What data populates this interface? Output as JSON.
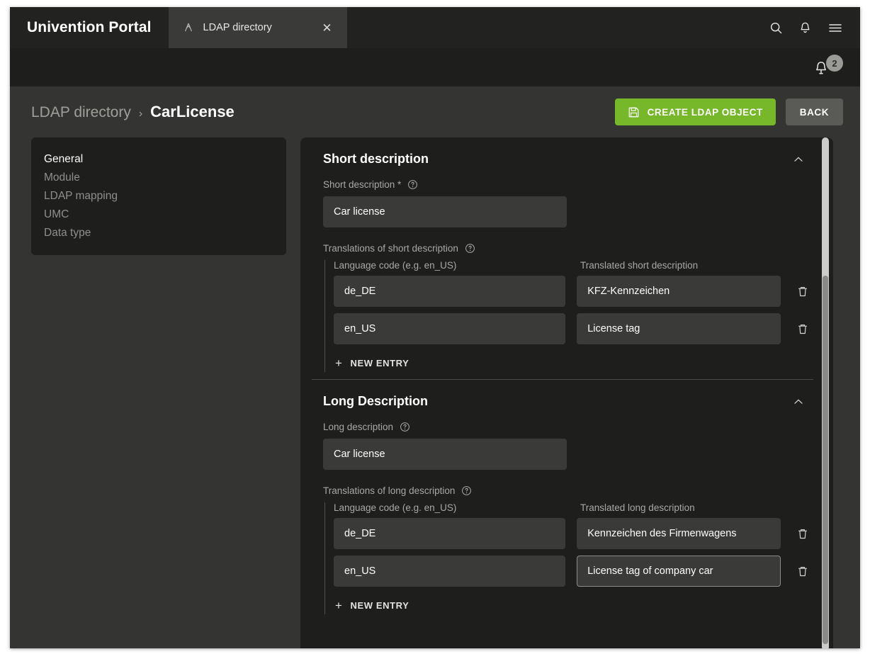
{
  "window": {
    "brand_title": "Univention Portal",
    "tab": {
      "label": "LDAP directory",
      "icon": "univention-ldap-icon",
      "close_icon": "close-icon"
    },
    "toolbar_icons": [
      "search-icon",
      "bell-icon",
      "hamburger-menu-icon"
    ]
  },
  "notification_bar": {
    "icon": "bell-icon",
    "badge_count": "2"
  },
  "header": {
    "breadcrumb_parent": "LDAP directory",
    "breadcrumb_separator": "›",
    "breadcrumb_current": "CarLicense",
    "create_button_label": "CREATE LDAP OBJECT",
    "create_button_icon": "save-floppy-icon",
    "create_button_color": "#76b82a",
    "back_button_label": "BACK",
    "back_button_color": "#5a5a57"
  },
  "sidebar": {
    "items": [
      {
        "label": "General",
        "active": true
      },
      {
        "label": "Module",
        "active": false
      },
      {
        "label": "LDAP mapping",
        "active": false
      },
      {
        "label": "UMC",
        "active": false
      },
      {
        "label": "Data type",
        "active": false
      }
    ]
  },
  "sections": [
    {
      "title": "Short description",
      "collapse_icon": "chevron-up-icon",
      "main_field": {
        "label": "Short description *",
        "help_icon": "help-circle-icon",
        "value": "Car license"
      },
      "translations": {
        "label": "Translations of short description",
        "help_icon": "help-circle-icon",
        "column_headers": [
          "Language code (e.g. en_US)",
          "Translated short description"
        ],
        "rows": [
          {
            "code": "de_DE",
            "translation": "KFZ-Kennzeichen",
            "delete_icon": "trash-icon",
            "focused": false
          },
          {
            "code": "en_US",
            "translation": "License tag",
            "delete_icon": "trash-icon",
            "focused": false
          }
        ],
        "new_entry_label": "NEW ENTRY",
        "new_entry_icon": "plus-icon"
      }
    },
    {
      "title": "Long Description",
      "collapse_icon": "chevron-up-icon",
      "main_field": {
        "label": "Long description",
        "help_icon": "help-circle-icon",
        "value": "Car license"
      },
      "translations": {
        "label": "Translations of long description",
        "help_icon": "help-circle-icon",
        "column_headers": [
          "Language code (e.g. en_US)",
          "Translated long description"
        ],
        "rows": [
          {
            "code": "de_DE",
            "translation": "Kennzeichen des Firmenwagens",
            "delete_icon": "trash-icon",
            "focused": false
          },
          {
            "code": "en_US",
            "translation": "License tag of company car",
            "delete_icon": "trash-icon",
            "focused": true
          }
        ],
        "new_entry_label": "NEW ENTRY",
        "new_entry_icon": "plus-icon"
      }
    }
  ],
  "scrollbar": {
    "name": "panel-scrollbar"
  }
}
